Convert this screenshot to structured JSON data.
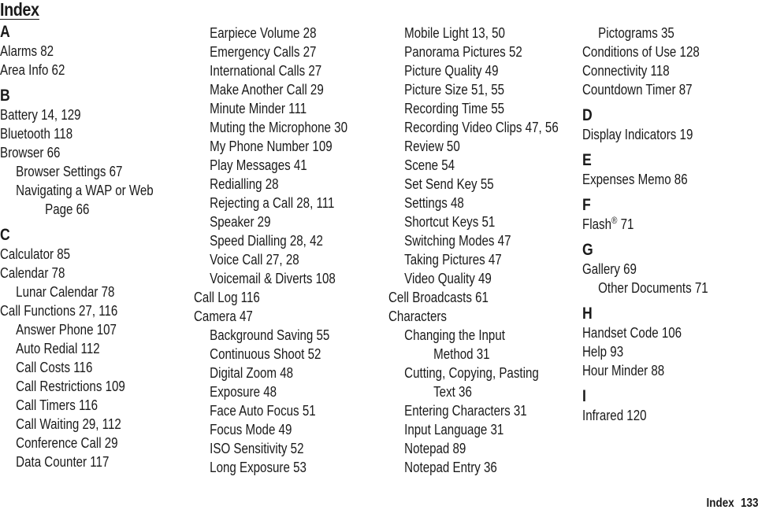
{
  "title": "Index",
  "columns": [
    [
      {
        "t": "letter",
        "text": "A"
      },
      {
        "t": "l0",
        "text": "Alarms 82"
      },
      {
        "t": "l0",
        "text": "Area Info 62"
      },
      {
        "t": "letter",
        "text": "B"
      },
      {
        "t": "l0",
        "text": "Battery 14, 129"
      },
      {
        "t": "l0",
        "text": "Bluetooth 118"
      },
      {
        "t": "l0",
        "text": "Browser 66"
      },
      {
        "t": "l1",
        "text": "Browser Settings 67"
      },
      {
        "t": "l1",
        "text": "Navigating a WAP or Web"
      },
      {
        "t": "l2",
        "text": "Page 66"
      },
      {
        "t": "letter",
        "text": "C"
      },
      {
        "t": "l0",
        "text": "Calculator 85"
      },
      {
        "t": "l0",
        "text": "Calendar 78"
      },
      {
        "t": "l1",
        "text": "Lunar Calendar 78"
      },
      {
        "t": "l0",
        "text": "Call Functions 27, 116"
      },
      {
        "t": "l1",
        "text": "Answer Phone 107"
      },
      {
        "t": "l1",
        "text": "Auto Redial 112"
      },
      {
        "t": "l1",
        "text": "Call Costs 116"
      },
      {
        "t": "l1",
        "text": "Call Restrictions 109"
      },
      {
        "t": "l1",
        "text": "Call Timers 116"
      },
      {
        "t": "l1",
        "text": "Call Waiting 29, 112"
      },
      {
        "t": "l1",
        "text": "Conference Call 29"
      },
      {
        "t": "l1",
        "text": "Data Counter 117"
      }
    ],
    [
      {
        "t": "l1",
        "text": "Earpiece Volume 28"
      },
      {
        "t": "l1",
        "text": "Emergency Calls 27"
      },
      {
        "t": "l1",
        "text": "International Calls 27"
      },
      {
        "t": "l1",
        "text": "Make Another Call 29"
      },
      {
        "t": "l1",
        "text": "Minute Minder 111"
      },
      {
        "t": "l1",
        "text": "Muting the Microphone 30"
      },
      {
        "t": "l1",
        "text": "My Phone Number 109"
      },
      {
        "t": "l1",
        "text": "Play Messages 41"
      },
      {
        "t": "l1",
        "text": "Redialling 28"
      },
      {
        "t": "l1",
        "text": "Rejecting a Call 28, 111"
      },
      {
        "t": "l1",
        "text": "Speaker 29"
      },
      {
        "t": "l1",
        "text": "Speed Dialling 28, 42"
      },
      {
        "t": "l1",
        "text": "Voice Call 27, 28"
      },
      {
        "t": "l1",
        "text": "Voicemail & Diverts 108"
      },
      {
        "t": "l0",
        "text": "Call Log 116"
      },
      {
        "t": "l0",
        "text": "Camera 47"
      },
      {
        "t": "l1",
        "text": "Background Saving 55"
      },
      {
        "t": "l1",
        "text": "Continuous Shoot 52"
      },
      {
        "t": "l1",
        "text": "Digital Zoom 48"
      },
      {
        "t": "l1",
        "text": "Exposure 48"
      },
      {
        "t": "l1",
        "text": "Face Auto Focus 51"
      },
      {
        "t": "l1",
        "text": "Focus Mode 49"
      },
      {
        "t": "l1",
        "text": "ISO Sensitivity 52"
      },
      {
        "t": "l1",
        "text": "Long Exposure 53"
      }
    ],
    [
      {
        "t": "l1",
        "text": "Mobile Light 13, 50"
      },
      {
        "t": "l1",
        "text": "Panorama Pictures 52"
      },
      {
        "t": "l1",
        "text": "Picture Quality 49"
      },
      {
        "t": "l1",
        "text": "Picture Size 51, 55"
      },
      {
        "t": "l1",
        "text": "Recording Time 55"
      },
      {
        "t": "l1",
        "text": "Recording Video Clips 47, 56"
      },
      {
        "t": "l1",
        "text": "Review 50"
      },
      {
        "t": "l1",
        "text": "Scene 54"
      },
      {
        "t": "l1",
        "text": "Set Send Key 55"
      },
      {
        "t": "l1",
        "text": "Settings 48"
      },
      {
        "t": "l1",
        "text": "Shortcut Keys 51"
      },
      {
        "t": "l1",
        "text": "Switching Modes 47"
      },
      {
        "t": "l1",
        "text": "Taking Pictures 47"
      },
      {
        "t": "l1",
        "text": "Video Quality 49"
      },
      {
        "t": "l0",
        "text": "Cell Broadcasts 61"
      },
      {
        "t": "l0",
        "text": "Characters"
      },
      {
        "t": "l1",
        "text": "Changing the Input"
      },
      {
        "t": "l2",
        "text": "Method 31"
      },
      {
        "t": "l1",
        "text": "Cutting, Copying, Pasting"
      },
      {
        "t": "l2",
        "text": "Text 36"
      },
      {
        "t": "l1",
        "text": "Entering Characters 31"
      },
      {
        "t": "l1",
        "text": "Input Language 31"
      },
      {
        "t": "l1",
        "text": "Notepad 89"
      },
      {
        "t": "l1",
        "text": "Notepad Entry 36"
      }
    ],
    [
      {
        "t": "l1",
        "text": "Pictograms 35"
      },
      {
        "t": "l0",
        "text": "Conditions of Use 128"
      },
      {
        "t": "l0",
        "text": "Connectivity 118"
      },
      {
        "t": "l0",
        "text": "Countdown Timer 87"
      },
      {
        "t": "letter",
        "text": "D"
      },
      {
        "t": "l0",
        "text": "Display Indicators 19"
      },
      {
        "t": "letter",
        "text": "E"
      },
      {
        "t": "l0",
        "text": "Expenses Memo 86"
      },
      {
        "t": "letter",
        "text": "F"
      },
      {
        "t": "l0",
        "text": "Flash",
        "sup": "®",
        "after": " 71"
      },
      {
        "t": "letter",
        "text": "G"
      },
      {
        "t": "l0",
        "text": "Gallery 69"
      },
      {
        "t": "l1",
        "text": "Other Documents 71"
      },
      {
        "t": "letter",
        "text": "H"
      },
      {
        "t": "l0",
        "text": "Handset Code 106"
      },
      {
        "t": "l0",
        "text": "Help 93"
      },
      {
        "t": "l0",
        "text": "Hour Minder 88"
      },
      {
        "t": "letter",
        "text": "I"
      },
      {
        "t": "l0",
        "text": "Infrared 120"
      }
    ]
  ],
  "footer": {
    "section": "Index",
    "page_number": "133"
  }
}
